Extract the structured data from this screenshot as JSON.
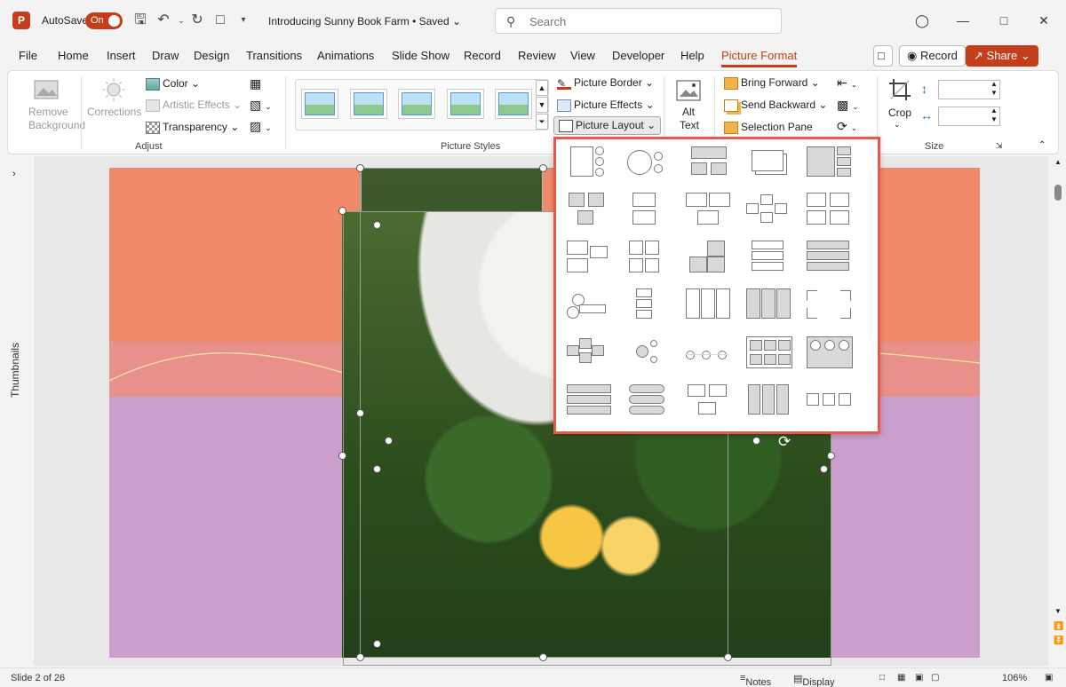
{
  "titlebar": {
    "app_logo": "P",
    "autosave_label": "AutoSave",
    "autosave_state": "On",
    "doc_title": "Introducing Sunny Book Farm • Saved",
    "search_placeholder": "Search"
  },
  "tabs": [
    "File",
    "Home",
    "Insert",
    "Draw",
    "Design",
    "Transitions",
    "Animations",
    "Slide Show",
    "Record",
    "Review",
    "View",
    "Developer",
    "Help",
    "Picture Format"
  ],
  "active_tab": "Picture Format",
  "header_buttons": {
    "record": "Record",
    "share": "Share"
  },
  "ribbon": {
    "adjust": {
      "remove_bg_line1": "Remove",
      "remove_bg_line2": "Background",
      "corrections": "Corrections",
      "color": "Color",
      "artistic_effects": "Artistic Effects",
      "transparency": "Transparency",
      "label": "Adjust"
    },
    "picture_styles": {
      "label": "Picture Styles",
      "picture_border": "Picture Border",
      "picture_effects": "Picture Effects",
      "picture_layout": "Picture Layout"
    },
    "accessibility": {
      "alt_line1": "Alt",
      "alt_line2": "Text"
    },
    "arrange": {
      "bring_forward": "Bring Forward",
      "send_backward": "Send Backward",
      "selection_pane": "Selection Pane"
    },
    "size": {
      "crop": "Crop",
      "label": "Size"
    }
  },
  "thumbnails_label": "Thumbnails",
  "status": {
    "slide": "Slide 2 of 26",
    "notes": "Notes",
    "display_settings": "Display Settings",
    "zoom": "106%"
  },
  "colors": {
    "accent": "#c43e1c",
    "highlight_border": "#e55a4e",
    "slide_top": "#f08a6b",
    "slide_bottom": "#cb9fcc"
  }
}
